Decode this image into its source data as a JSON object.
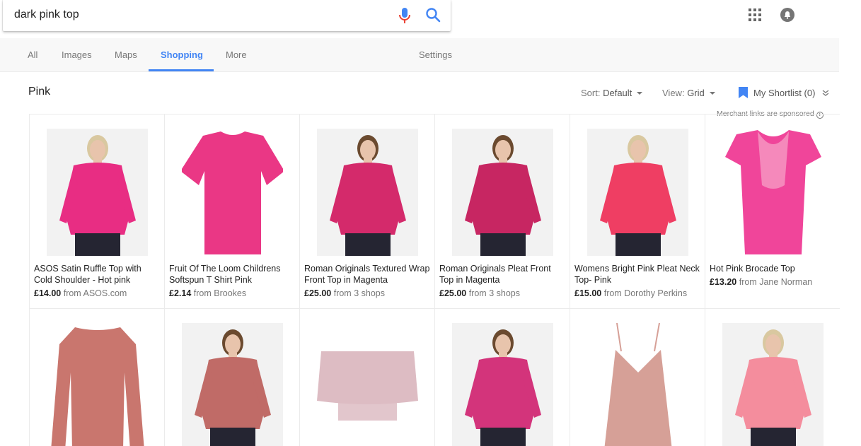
{
  "search": {
    "query": "dark pink top"
  },
  "tabs": [
    {
      "label": "All"
    },
    {
      "label": "Images"
    },
    {
      "label": "Maps"
    },
    {
      "label": "Shopping"
    },
    {
      "label": "More"
    }
  ],
  "settings_label": "Settings",
  "active_tab": "Shopping",
  "toolbar": {
    "section_title": "Pink",
    "sort_label": "Sort:",
    "sort_value": "Default",
    "view_label": "View:",
    "view_value": "Grid",
    "shortlist_label": "My Shortlist (0)",
    "sponsored_note": "Merchant links are sponsored"
  },
  "colors": {
    "accent": "#4285f4",
    "mic_red": "#ea4335",
    "mic_blue": "#4285f4"
  },
  "products": [
    {
      "title": "ASOS Satin Ruffle Top with Cold Shoulder - Hot pink",
      "price": "£14.00",
      "from": "from ASOS.com",
      "color": "#e82d83"
    },
    {
      "title": "Fruit Of The Loom Childrens Softspun T Shirt Pink",
      "price": "£2.14",
      "from": "from Brookes",
      "color": "#ea3785"
    },
    {
      "title": "Roman Originals Textured Wrap Front Top in Magenta",
      "price": "£25.00",
      "from": "from 3 shops",
      "color": "#d42a6b"
    },
    {
      "title": "Roman Originals Pleat Front Top in Magenta",
      "price": "£25.00",
      "from": "from 3 shops",
      "color": "#c72662"
    },
    {
      "title": "Womens Bright Pink Pleat Neck Top- Pink",
      "price": "£15.00",
      "from": "from Dorothy Perkins",
      "color": "#ef3e63"
    },
    {
      "title": "Hot Pink Brocade Top",
      "price": "£13.20",
      "from": "from Jane Norman",
      "color": "#f0459a"
    },
    {
      "title": "",
      "price": "",
      "from": "",
      "color": "#c9766e"
    },
    {
      "title": "",
      "price": "",
      "from": "",
      "color": "#c06b67"
    },
    {
      "title": "",
      "price": "",
      "from": "",
      "color": "#ddbcc3"
    },
    {
      "title": "",
      "price": "",
      "from": "",
      "color": "#d3347b"
    },
    {
      "title": "",
      "price": "",
      "from": "",
      "color": "#d6a097"
    },
    {
      "title": "",
      "price": "",
      "from": "",
      "color": "#f48d9d"
    }
  ]
}
